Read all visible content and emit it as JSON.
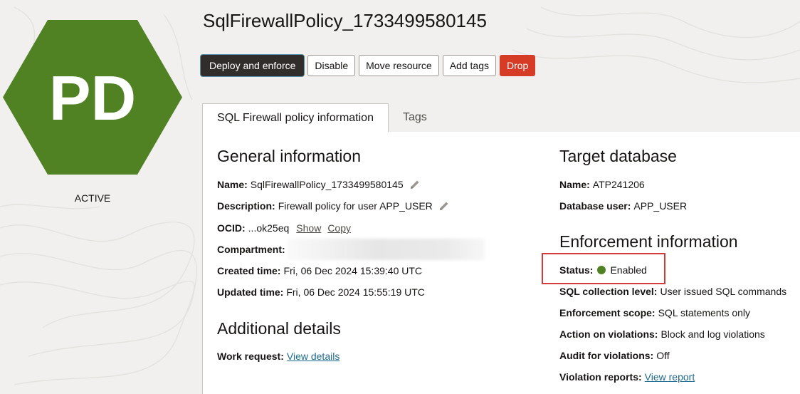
{
  "header": {
    "title": "SqlFirewallPolicy_1733499580145"
  },
  "badge": {
    "initials": "PD",
    "state": "ACTIVE",
    "color": "#508223",
    "icon": "hexagon-icon"
  },
  "toolbar": {
    "deploy": "Deploy and enforce",
    "disable": "Disable",
    "move": "Move resource",
    "add_tags": "Add tags",
    "drop": "Drop"
  },
  "tabs": {
    "info": "SQL Firewall policy information",
    "tags": "Tags"
  },
  "general": {
    "heading": "General information",
    "name_label": "Name:",
    "name_value": "SqlFirewallPolicy_1733499580145",
    "desc_label": "Description:",
    "desc_value": "Firewall policy for user APP_USER",
    "ocid_label": "OCID:",
    "ocid_value": "...ok25eq",
    "ocid_show": "Show",
    "ocid_copy": "Copy",
    "compartment_label": "Compartment:",
    "created_label": "Created time:",
    "created_value": "Fri, 06 Dec 2024 15:39:40 UTC",
    "updated_label": "Updated time:",
    "updated_value": "Fri, 06 Dec 2024 15:55:19 UTC"
  },
  "additional": {
    "heading": "Additional details",
    "work_label": "Work request:",
    "work_link": "View details"
  },
  "target": {
    "heading": "Target database",
    "name_label": "Name:",
    "name_value": "ATP241206",
    "user_label": "Database user:",
    "user_value": "APP_USER"
  },
  "enforcement": {
    "heading": "Enforcement information",
    "status_label": "Status:",
    "status_value": "Enabled",
    "status_color": "#508223",
    "level_label": "SQL collection level:",
    "level_value": "User issued SQL commands",
    "scope_label": "Enforcement scope:",
    "scope_value": "SQL statements only",
    "action_label": "Action on violations:",
    "action_value": "Block and log violations",
    "audit_label": "Audit for violations:",
    "audit_value": "Off",
    "reports_label": "Violation reports:",
    "reports_link": "View report"
  },
  "colors": {
    "accent_link": "#1d6b8f",
    "danger": "#d63b25",
    "highlight_box": "#d63a3a"
  }
}
